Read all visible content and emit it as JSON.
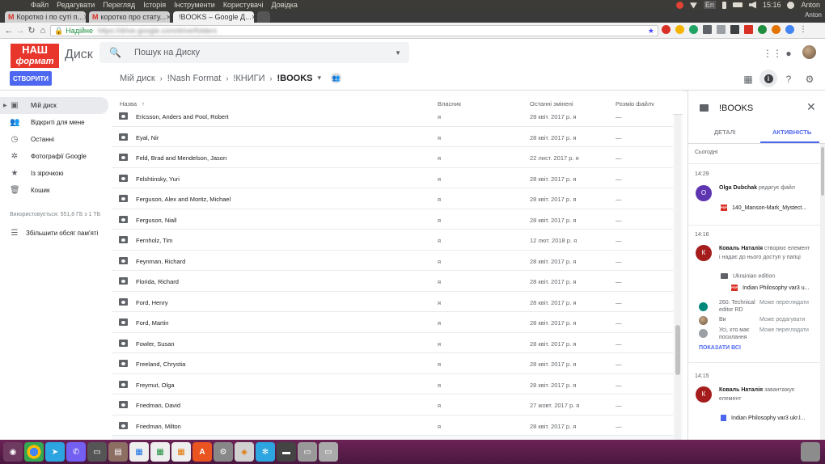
{
  "system_menu": [
    "Файл",
    "Редагувати",
    "Перегляд",
    "Історія",
    "Інструменти",
    "Користувачі",
    "Довідка"
  ],
  "system_tray": {
    "lang": "En",
    "time": "15:16",
    "user": "Anton"
  },
  "browser": {
    "tabs": [
      {
        "title": "Коротко і по суті п...",
        "icon": "gmail-icon"
      },
      {
        "title": "коротко про стату...",
        "icon": "gmail-icon"
      },
      {
        "title": "!BOOKS – Google Д...",
        "icon": "drive-icon"
      }
    ],
    "profile": "Anton",
    "secure_label": "Надійне",
    "url": "https://drive.google.com/drive/folders"
  },
  "drive": {
    "logo_line1": "НАШ",
    "logo_line2": "формат",
    "app_name": "Диск",
    "search_placeholder": "Пошук на Диску",
    "create_label": "СТВОРИТИ",
    "breadcrumb": [
      "Мій диск",
      "!Nash Format",
      "!КНИГИ",
      "!BOOKS"
    ]
  },
  "sidebar": {
    "items": [
      {
        "label": "Мій диск",
        "icon": "my-drive-icon"
      },
      {
        "label": "Відкриті для мене",
        "icon": "shared-people-icon"
      },
      {
        "label": "Останні",
        "icon": "clock-icon"
      },
      {
        "label": "Фотографії Google",
        "icon": "pinwheel-icon"
      },
      {
        "label": "Із зірочкою",
        "icon": "star-icon"
      },
      {
        "label": "Кошик",
        "icon": "trash-icon"
      }
    ],
    "storage": "Використовується: 551,8 ГБ з 1 ТБ",
    "upgrade": "Збільшити обсяг пам'яті"
  },
  "filelist": {
    "columns": {
      "name": "Назва",
      "owner": "Власник",
      "modified": "Останні змінені",
      "size": "Розмір файлу"
    },
    "rows": [
      {
        "name": "Ericsson, Anders and Pool, Robert",
        "owner": "я",
        "modified": "28 квіт. 2017 р. я",
        "size": "—"
      },
      {
        "name": "Eyal, Nir",
        "owner": "я",
        "modified": "28 квіт. 2017 р. я",
        "size": "—"
      },
      {
        "name": "Feld, Brad and Mendelson, Jason",
        "owner": "я",
        "modified": "22 лист. 2017 р. я",
        "size": "—"
      },
      {
        "name": "Felshtinsky, Yuri",
        "owner": "я",
        "modified": "28 квіт. 2017 р. я",
        "size": "—"
      },
      {
        "name": "Ferguson, Alex and Moritz, Michael",
        "owner": "я",
        "modified": "28 квіт. 2017 р. я",
        "size": "—"
      },
      {
        "name": "Ferguson, Niall",
        "owner": "я",
        "modified": "28 квіт. 2017 р. я",
        "size": "—"
      },
      {
        "name": "Fernholz, Tim",
        "owner": "я",
        "modified": "12 лют. 2018 р. я",
        "size": "—"
      },
      {
        "name": "Feynman, Richard",
        "owner": "я",
        "modified": "28 квіт. 2017 р. я",
        "size": "—"
      },
      {
        "name": "Florida, Richard",
        "owner": "я",
        "modified": "28 квіт. 2017 р. я",
        "size": "—"
      },
      {
        "name": "Ford, Henry",
        "owner": "я",
        "modified": "28 квіт. 2017 р. я",
        "size": "—"
      },
      {
        "name": "Ford, Martin",
        "owner": "я",
        "modified": "28 квіт. 2017 р. я",
        "size": "—"
      },
      {
        "name": "Fowler, Susan",
        "owner": "я",
        "modified": "28 квіт. 2017 р. я",
        "size": "—"
      },
      {
        "name": "Freeland, Chrystia",
        "owner": "я",
        "modified": "28 квіт. 2017 р. я",
        "size": "—"
      },
      {
        "name": "Freymut, Olga",
        "owner": "я",
        "modified": "28 квіт. 2017 р. я",
        "size": "—"
      },
      {
        "name": "Friedman, David",
        "owner": "я",
        "modified": "27 жовт. 2017 р. я",
        "size": "—"
      },
      {
        "name": "Friedman, Milton",
        "owner": "я",
        "modified": "28 квіт. 2017 р. я",
        "size": "—"
      }
    ]
  },
  "panel": {
    "title": "!BOOKS",
    "tab_details": "ДЕТАЛІ",
    "tab_activity": "АКТИВНІСТЬ",
    "today": "Сьогодні",
    "e1": {
      "time": "14:29",
      "initial": "O",
      "user": "Olga Dubchak",
      "action": "редагує файл",
      "file": "140_Manson-Mark_Mystect..."
    },
    "e2": {
      "time": "14:16",
      "initial": "К",
      "user": "Коваль Наталія",
      "action": "створює елемент",
      "action2": "і надає до нього доступ у папці",
      "folder": "Ukrainian edition",
      "file": "Indian Philosophy var3 u...",
      "share1_name": "260. Technical",
      "share1_name2": "editor RD",
      "share1_role": "Може переглядати",
      "share2_name": "Ви",
      "share2_role": "Може редагувати",
      "share3_name": "Усі, хто має",
      "share3_name2": "посилання",
      "share3_role": "Може переглядати",
      "show_all": "ПОКАЗАТИ ВСІ"
    },
    "e3": {
      "time": "14:15",
      "initial": "К",
      "user": "Коваль Наталія",
      "action": "завантажує",
      "action2": "елемент",
      "file": "Indian Philosophy var3 ukr.l..."
    }
  },
  "colors": {
    "accent": "#4d67f0",
    "logo_red": "#e8362c",
    "avatar_olga": "#5e35b1",
    "avatar_koval": "#a51c1c",
    "dock": "#5c1d4b"
  }
}
